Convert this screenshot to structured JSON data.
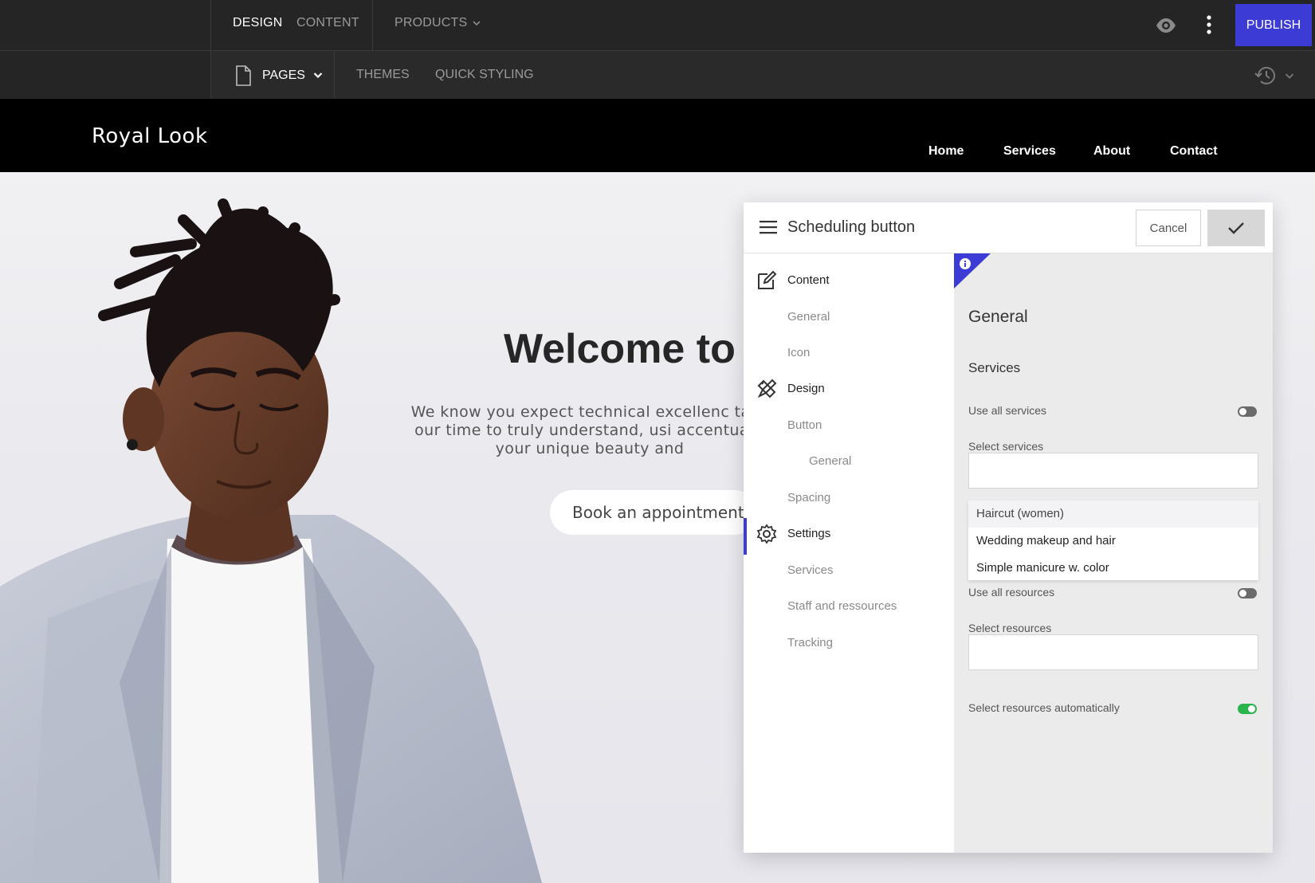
{
  "editor": {
    "tabs": [
      "DESIGN",
      "CONTENT",
      "PRODUCTS"
    ],
    "publish_label": "PUBLISH",
    "subtabs": {
      "pages": "PAGES",
      "themes": "THEMES",
      "quick_styling": "QUICK STYLING"
    },
    "colors": {
      "bar": "#252525",
      "publish": "#3d3bd6"
    }
  },
  "site": {
    "brand": "Royal Look",
    "nav": [
      "Home",
      "Services",
      "About",
      "Contact"
    ],
    "hero_title": "Welcome to R",
    "hero_text": "We know you expect technical excellenc take our time to truly understand, usi accentuate your unique beauty and",
    "book_label": "Book an appointment"
  },
  "panel": {
    "title": "Scheduling button",
    "cancel_label": "Cancel",
    "nav": {
      "content": "Content",
      "general": "General",
      "icon": "Icon",
      "design": "Design",
      "button": "Button",
      "button_general": "General",
      "spacing": "Spacing",
      "settings": "Settings",
      "services": "Services",
      "staff": "Staff and ressources",
      "tracking": "Tracking"
    },
    "body": {
      "heading": "General",
      "subheading": "Services",
      "use_all_services": "Use all services",
      "select_services": "Select services",
      "services_options": [
        "Haircut (women)",
        "Wedding makeup and hair",
        "Simple manicure w. color"
      ],
      "use_all_resources": "Use all resources",
      "select_resources": "Select resources",
      "auto_resources": "Select resources automatically"
    },
    "toggles": {
      "use_all_services": false,
      "use_all_resources": false,
      "auto_resources": true
    },
    "colors": {
      "accent": "#3d3bd6",
      "toggle_on": "#29b44c"
    }
  }
}
